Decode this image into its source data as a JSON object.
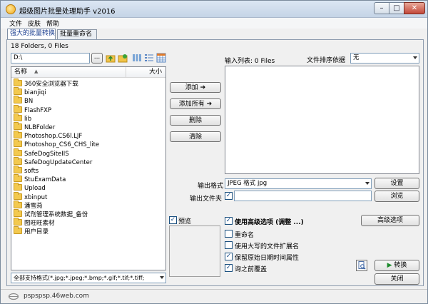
{
  "window": {
    "title": "超级图片批量处理助手  v2016"
  },
  "menu": [
    "文件",
    "皮肤",
    "帮助"
  ],
  "tabs": [
    "强大的批量转换",
    "批量重命名"
  ],
  "left": {
    "summary": "18 Folders, 0 Files",
    "path": "D:\\",
    "browse_label": "...",
    "col_name": "名称",
    "col_size": "大小",
    "folders": [
      "360安全浏览器下载",
      "bianjiqi",
      "BN",
      "FlashFXP",
      "lib",
      "NLBFolder",
      "Photoshop.CS6l.LJF",
      "Photoshop_CS6_CHS_lite",
      "SafeDogSiteIIS",
      "SafeDogUpdateCenter",
      "softs",
      "StuExamData",
      "Upload",
      "xbinput",
      "潘雪燕",
      "试剂管理系统数据_备份",
      "图旺旺素材",
      "用户目录"
    ],
    "filter": "全部支持格式(*.jpg;*.jpeg;*.bmp;*.gif;*.tif;*.tiff;"
  },
  "middle": {
    "add_label": "添加",
    "add_all_label": "添加所有",
    "delete_label": "删除",
    "clear_label": "清除"
  },
  "right": {
    "input_list_label": "输入列表: 0 Files",
    "sort_label": "文件排序依据",
    "sort_value": "无",
    "output_format_label": "输出格式",
    "output_format_value": "JPEG 格式 jpg",
    "settings_label": "设置",
    "output_folder_label": "输出文件夹",
    "browse_label": "浏览",
    "preview_label": "预览",
    "advanced_option_label": "使用高级选项 (调整 ...)",
    "advanced_btn_label": "高级选项",
    "opts": [
      {
        "label": "重命名",
        "checked": false
      },
      {
        "label": "使用大写的文件扩展名",
        "checked": false
      },
      {
        "label": "保留原始日期时间属性",
        "checked": true
      },
      {
        "label": "询之前覆盖",
        "checked": true
      }
    ],
    "convert_label": "转换",
    "close_label": "关闭"
  },
  "status": {
    "url": "pspspsp.46web.com"
  }
}
